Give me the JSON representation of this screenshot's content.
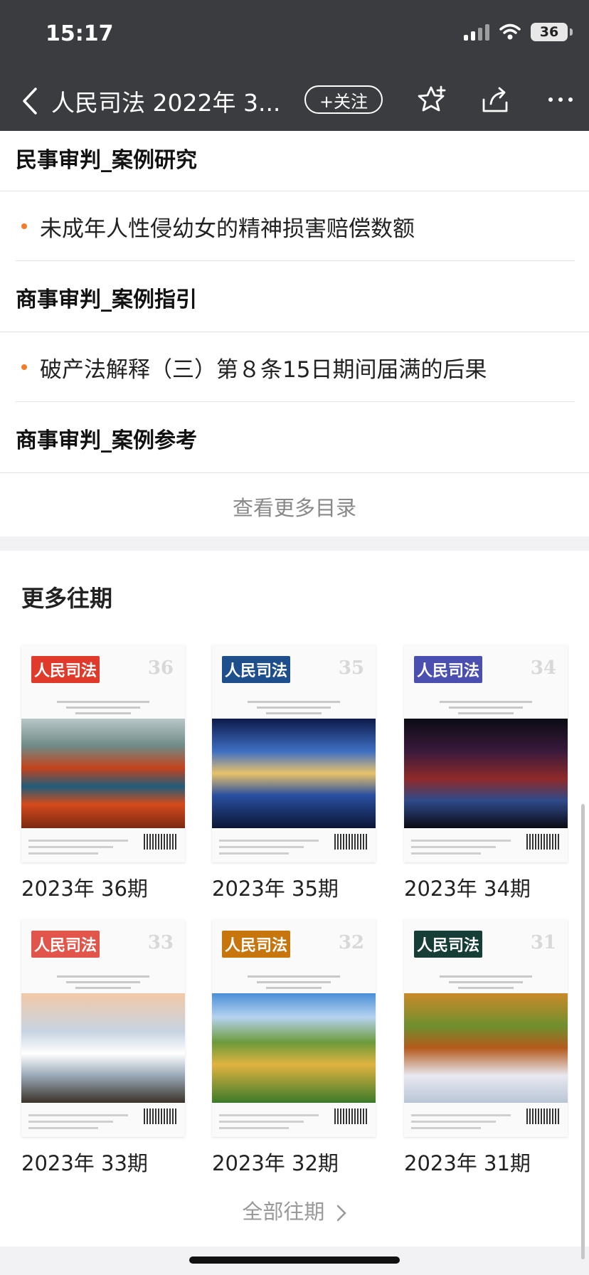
{
  "status": {
    "time": "15:17",
    "battery": "36"
  },
  "nav": {
    "title": "人民司法 2022年 3...",
    "follow_label": "+关注"
  },
  "toc": [
    {
      "kind": "section",
      "text": "民事审判_案例研究"
    },
    {
      "kind": "article",
      "text": "未成年人性侵幼女的精神损害赔偿数额"
    },
    {
      "kind": "section",
      "text": "商事审判_案例指引"
    },
    {
      "kind": "article",
      "text": "破产法解释（三）第８条15日期间届满的后果"
    },
    {
      "kind": "section",
      "text": "商事审判_案例参考"
    }
  ],
  "more_toc_label": "查看更多目录",
  "more_issues": {
    "title": "更多往期",
    "items": [
      {
        "label": "2023年 36期",
        "cover_title": "人民司法",
        "cover_number": "36",
        "logo_color": "#e03a2a",
        "theme": "autumn-forest"
      },
      {
        "label": "2023年 35期",
        "cover_title": "人民司法",
        "cover_number": "35",
        "logo_color": "#1e4f8c",
        "theme": "night-bridge"
      },
      {
        "label": "2023年 34期",
        "cover_title": "人民司法",
        "cover_number": "34",
        "logo_color": "#4a4fb0",
        "theme": "dark-forest"
      },
      {
        "label": "2023年 33期",
        "cover_title": "人民司法",
        "cover_number": "33",
        "logo_color": "#e2554a",
        "theme": "great-wall-mist"
      },
      {
        "label": "2023年 32期",
        "cover_title": "人民司法",
        "cover_number": "32",
        "logo_color": "#c7760e",
        "theme": "farmland"
      },
      {
        "label": "2023年 31期",
        "cover_title": "人民司法",
        "cover_number": "31",
        "logo_color": "#173e36",
        "theme": "horses-autumn"
      }
    ],
    "all_label": "全部往期"
  }
}
